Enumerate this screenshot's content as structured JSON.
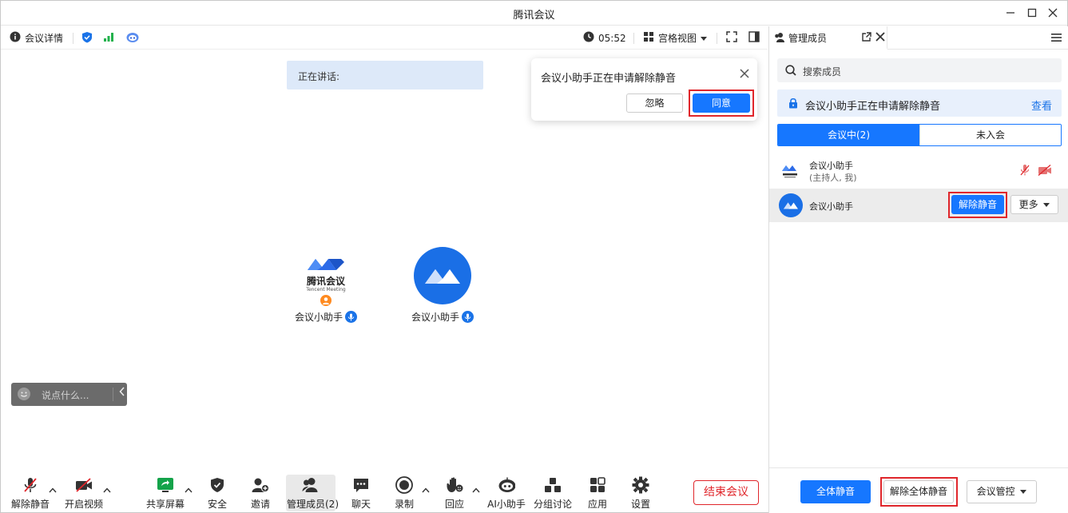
{
  "window": {
    "title": "腾讯会议"
  },
  "topbar": {
    "meeting_details": "会议详情",
    "timer": "05:52",
    "view_mode": "宫格视图"
  },
  "main": {
    "speaking_label": "正在讲话:",
    "popup": {
      "message": "会议小助手正在申请解除静音",
      "ignore": "忽略",
      "agree": "同意"
    },
    "tiles": [
      {
        "name": "会议小助手",
        "logo_text": "腾讯会议",
        "logo_subtext": "Tencent Meeting"
      },
      {
        "name": "会议小助手"
      }
    ],
    "chat_placeholder": "说点什么..."
  },
  "bottombar": {
    "unmute": "解除静音",
    "start_video": "开启视频",
    "share_screen": "共享屏幕",
    "security": "安全",
    "invite": "邀请",
    "manage_members": "管理成员(2)",
    "chat": "聊天",
    "record": "录制",
    "reactions": "回应",
    "ai_assistant": "AI小助手",
    "breakout": "分组讨论",
    "apps": "应用",
    "settings": "设置",
    "end_meeting": "结束会议"
  },
  "panel": {
    "title": "管理成员",
    "search_placeholder": "搜索成员",
    "notice": "会议小助手正在申请解除静音",
    "notice_link": "查看",
    "tab_in_meeting": "会议中(2)",
    "tab_not_joined": "未入会",
    "members": [
      {
        "name": "会议小助手",
        "role": "(主持人, 我)"
      },
      {
        "name": "会议小助手",
        "unmute": "解除静音",
        "more": "更多"
      }
    ],
    "mute_all": "全体静音",
    "unmute_all": "解除全体静音",
    "meeting_control": "会议管控"
  },
  "colors": {
    "accent": "#1677ff",
    "highlight": "#e0262b",
    "speaking_bg": "#dde9f9"
  }
}
